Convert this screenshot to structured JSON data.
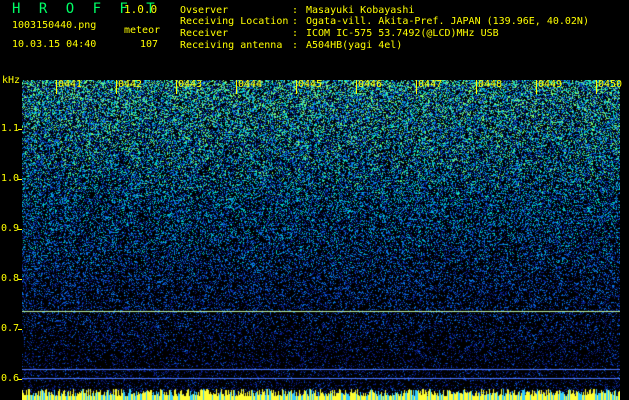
{
  "header": {
    "app_title": "H R O F F T",
    "version": "1.0.0",
    "filename": "1003150440.png",
    "datetime": "10.03.15 04:40",
    "meteor_label": "meteor",
    "meteor_count": "107"
  },
  "info": [
    {
      "label": "Ovserver",
      "value": "Masayuki Kobayashi"
    },
    {
      "label": "Receiving Location",
      "value": "Ogata-vill. Akita-Pref. JAPAN (139.96E, 40.02N)"
    },
    {
      "label": "Receiver",
      "value": "ICOM IC-575 53.7492(@LCD)MHz USB"
    },
    {
      "label": "Receiving antenna",
      "value": "A504HB(yagi 4el)"
    }
  ],
  "separator": ":",
  "axis": {
    "unit": "kHz",
    "y_ticks": [
      "1.1",
      "1.0",
      "0.9",
      "0.8",
      "0.7",
      "0.6"
    ],
    "x_ticks": [
      "0441",
      "0442",
      "0443",
      "0444",
      "0445",
      "0446",
      "0447",
      "0448",
      "0449",
      "0450"
    ]
  },
  "colors": {
    "text": "#ffff00",
    "title": "#00ff66",
    "background": "#000000",
    "noise_low": "#0a1a8c",
    "noise_high": "#2cff7a",
    "carrier_line": "#b8f0a0"
  }
}
